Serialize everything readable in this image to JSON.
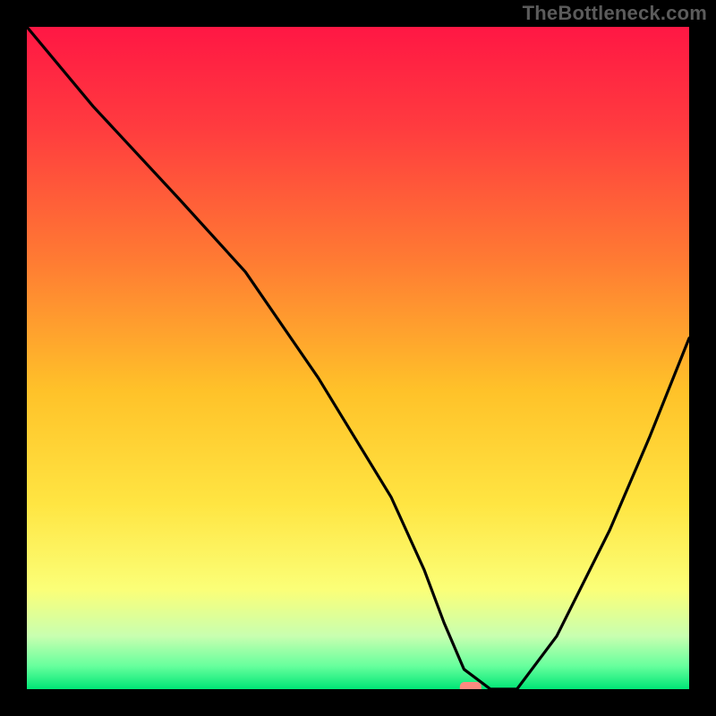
{
  "watermark": "TheBottleneck.com",
  "chart_data": {
    "type": "line",
    "title": "",
    "xlabel": "",
    "ylabel": "",
    "xlim": [
      0,
      100
    ],
    "ylim": [
      0,
      100
    ],
    "grid": false,
    "legend": false,
    "background_gradient": {
      "stops": [
        {
          "offset": 0.0,
          "color": "#ff1744"
        },
        {
          "offset": 0.15,
          "color": "#ff3b3f"
        },
        {
          "offset": 0.35,
          "color": "#ff7a33"
        },
        {
          "offset": 0.55,
          "color": "#ffc229"
        },
        {
          "offset": 0.72,
          "color": "#ffe542"
        },
        {
          "offset": 0.85,
          "color": "#fbff78"
        },
        {
          "offset": 0.92,
          "color": "#c8ffb0"
        },
        {
          "offset": 0.965,
          "color": "#67ff9d"
        },
        {
          "offset": 1.0,
          "color": "#00e676"
        }
      ]
    },
    "series": [
      {
        "name": "bottleneck-curve",
        "color": "#000000",
        "x": [
          0,
          10,
          23,
          33,
          44,
          55,
          60,
          63,
          66,
          70,
          74,
          80,
          88,
          94,
          100
        ],
        "y": [
          100,
          88,
          74,
          63,
          47,
          29,
          18,
          10,
          3,
          0,
          0,
          8,
          24,
          38,
          53
        ]
      }
    ],
    "marker": {
      "name": "optimum-marker",
      "x": 67,
      "y": 0,
      "color": "#ff8a80",
      "shape": "rounded-rect"
    }
  }
}
